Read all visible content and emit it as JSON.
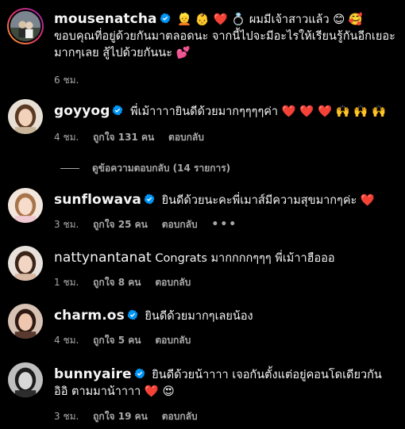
{
  "colors": {
    "background": "#000000",
    "text": "#f5f5f5",
    "meta": "#a8a8a8",
    "verified": "#0095f6",
    "heart": "#ff3040"
  },
  "comments": [
    {
      "username": "mousenatcha",
      "verified": true,
      "text": "👱 👶 ❤️ 💍 ผมมีเจ้าสาวแล้ว 😊 🥰 ขอบคุณที่อยู่ด้วยกันมาตลอดนะ จากนี้ไปจะมีอะไรให้เรียนรู้กันอีกเยอะมากๆเลย สู้ไปด้วยกันนะ 💕",
      "time": "6 ชม.",
      "likes": "",
      "reply": ""
    },
    {
      "username": "goyyog",
      "verified": true,
      "text": "พี่เม้าาาายินดีด้วยมากๆๆๆๆค่า ❤️ ❤️ ❤️ 🙌 🙌 🙌",
      "time": "4 ชม.",
      "likes": "ถูกใจ 131 คน",
      "reply": "ตอบกลับ"
    },
    {
      "username": "sunflowava",
      "verified": true,
      "text": "ยินดีด้วยนะคะพี่เมาส์มีความสุขมากๆค่ะ ❤️",
      "time": "3 ชม.",
      "likes": "ถูกใจ 25 คน",
      "reply": "ตอบกลับ",
      "more": "•••"
    },
    {
      "username": "nattynantanat",
      "verified": false,
      "text": "Congrats มากกกกๆๆๆ พี่เม้าาฮือออ",
      "time": "1 ชม.",
      "likes": "ถูกใจ 8 คน",
      "reply": "ตอบกลับ"
    },
    {
      "username": "charm.os",
      "verified": true,
      "text": "ยินดีด้วยมากๆเลยน้อง",
      "time": "4 ชม.",
      "likes": "ถูกใจ 5 คน",
      "reply": "ตอบกลับ"
    },
    {
      "username": "bunnyaire",
      "verified": true,
      "text": "ยินดีด้วยน้าาาา เจอกันตั้งแต่อยู่คอนโดเดียวกัน อิอิ ตามมาน้าาาา ❤️ 😍",
      "time": "3 ชม.",
      "likes": "ถูกใจ 19 คน",
      "reply": "ตอบกลับ"
    }
  ],
  "view_replies": "ดูข้อความตอบกลับ (14 รายการ)"
}
